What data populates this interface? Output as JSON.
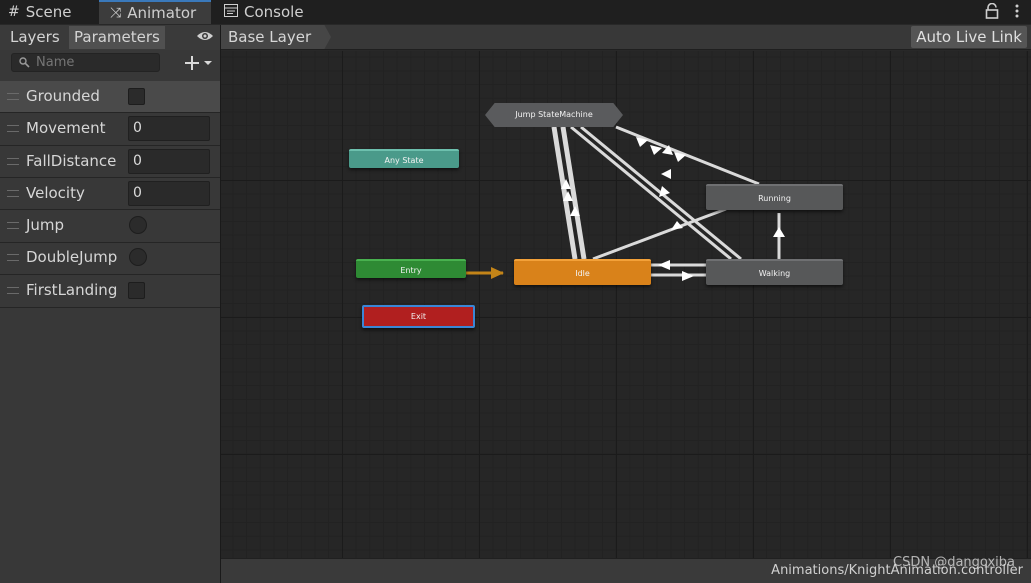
{
  "tabs": [
    {
      "label": "Scene",
      "icon": "grid-icon"
    },
    {
      "label": "Animator",
      "icon": "animator-icon"
    },
    {
      "label": "Console",
      "icon": "console-icon"
    }
  ],
  "left_panel": {
    "tabs": [
      "Layers",
      "Parameters"
    ],
    "search_placeholder": "Name",
    "parameters": [
      {
        "name": "Grounded",
        "type": "bool",
        "value": false,
        "selected": true
      },
      {
        "name": "Movement",
        "type": "float",
        "value": "0"
      },
      {
        "name": "FallDistance",
        "type": "float",
        "value": "0"
      },
      {
        "name": "Velocity",
        "type": "float",
        "value": "0"
      },
      {
        "name": "Jump",
        "type": "trigger"
      },
      {
        "name": "DoubleJump",
        "type": "trigger"
      },
      {
        "name": "FirstLanding",
        "type": "bool",
        "value": false
      }
    ]
  },
  "graph": {
    "breadcrumb": "Base Layer",
    "live_link_label": "Auto Live Link",
    "nodes": {
      "any_state": "Any State",
      "entry": "Entry",
      "exit": "Exit",
      "idle": "Idle",
      "walking": "Walking",
      "running": "Running",
      "jump_state_machine": "Jump StateMachine"
    }
  },
  "status_bar": {
    "path": "Animations/KnightAnimation.controller"
  },
  "watermark": "CSDN @dangoxiba",
  "colors": {
    "accent": "#3a79bb",
    "entry": "#2e8a34",
    "any_state": "#4a9a8a",
    "exit": "#b11f1f",
    "default_state": "#d9821a",
    "state": "#575859"
  }
}
